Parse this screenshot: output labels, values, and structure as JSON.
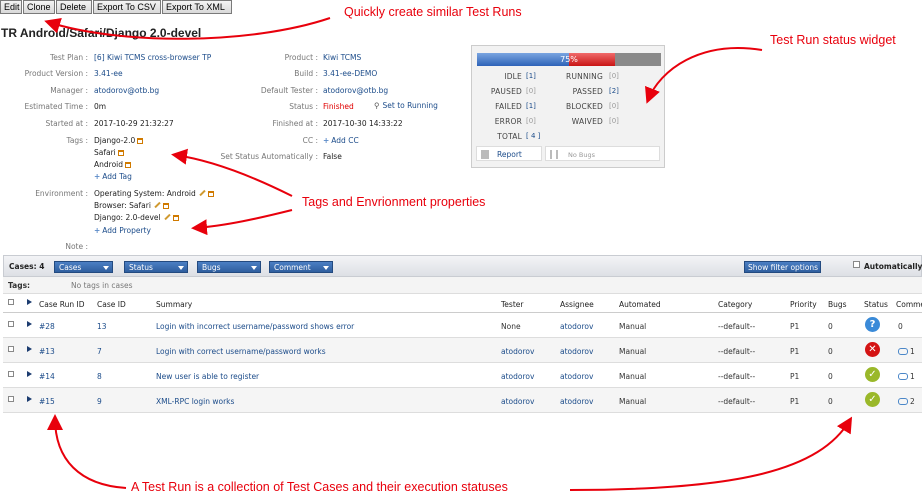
{
  "toolbar": {
    "edit": "Edit",
    "clone": "Clone",
    "delete": "Delete",
    "export_csv": "Export To CSV",
    "export_xml": "Export To XML"
  },
  "title": "TR Android/Safari/Django 2.0-devel",
  "details_left": {
    "test_plan_label": "Test Plan :",
    "test_plan_value": "[6] Kiwi TCMS cross-browser TP",
    "product_version_label": "Product Version :",
    "product_version_value": "3.41-ee",
    "manager_label": "Manager :",
    "manager_value": "atodorov@otb.bg",
    "estimated_time_label": "Estimated Time :",
    "estimated_time_value": "0m",
    "started_at_label": "Started at :",
    "started_at_value": "2017-10-29 21:32:27",
    "tags_label": "Tags :",
    "tags": [
      "Django-2.0",
      "Safari",
      "Android"
    ],
    "add_tag": "Add Tag",
    "environment_label": "Environment :",
    "environment": [
      "Operating System: Android",
      "Browser: Safari",
      "Django: 2.0-devel"
    ],
    "add_property": "Add Property",
    "note_label": "Note :"
  },
  "details_right": {
    "product_label": "Product :",
    "product_value": "Kiwi TCMS",
    "build_label": "Build :",
    "build_value": "3.41-ee-DEMO",
    "default_tester_label": "Default Tester :",
    "default_tester_value": "atodorov@otb.bg",
    "status_label": "Status :",
    "status_value": "Finished",
    "set_to_running": "Set to Running",
    "finished_at_label": "Finished at :",
    "finished_at_value": "2017-10-30 14:33:22",
    "cc_label": "CC :",
    "add_cc": "Add CC",
    "set_status_auto_label": "Set Status Automatically :",
    "set_status_auto_value": "False"
  },
  "status_widget": {
    "progress_percent": 75,
    "progress_label": "75%",
    "passed_fraction": 0.5,
    "failed_fraction": 0.25,
    "idle_label": "IDLE",
    "idle_count": "[1]",
    "running_label": "RUNNING",
    "running_count": "[0]",
    "paused_label": "PAUSED",
    "paused_count": "[0]",
    "passed_label": "PASSED",
    "passed_count": "[2]",
    "failed_label": "FAILED",
    "failed_count": "[1]",
    "blocked_label": "BLOCKED",
    "blocked_count": "[0]",
    "error_label": "ERROR",
    "error_count": "[0]",
    "waived_label": "WAIVED",
    "waived_count": "[0]",
    "total_label": "TOTAL",
    "total_count": "[ 4 ]",
    "report_label": "Report",
    "no_bugs_label": "No Bugs"
  },
  "filter_bar": {
    "cases_label": "Cases: 4",
    "cases_select": "Cases",
    "status_select": "Status",
    "bugs_select": "Bugs",
    "comment_select": "Comment",
    "show_filter": "Show filter options",
    "automatically": "Automatically"
  },
  "tags_row": {
    "label": "Tags:",
    "value": "No tags in cases"
  },
  "table": {
    "headers": {
      "case_run_id": "Case Run ID",
      "case_id": "Case ID",
      "summary": "Summary",
      "tester": "Tester",
      "assignee": "Assignee",
      "automated": "Automated",
      "category": "Category",
      "priority": "Priority",
      "bugs": "Bugs",
      "status": "Status",
      "comments": "Comme"
    },
    "rows": [
      {
        "run_id": "#28",
        "case_id": "13",
        "summary": "Login with incorrect username/password shows error",
        "tester": "None",
        "assignee": "atodorov",
        "automated": "Manual",
        "category": "--default--",
        "priority": "P1",
        "bugs": "0",
        "status": "idle",
        "status_glyph": "?",
        "comments": "0"
      },
      {
        "run_id": "#13",
        "case_id": "7",
        "summary": "Login with correct username/password works",
        "tester": "atodorov",
        "assignee": "atodorov",
        "automated": "Manual",
        "category": "--default--",
        "priority": "P1",
        "bugs": "0",
        "status": "failed",
        "status_glyph": "✕",
        "comments": "1"
      },
      {
        "run_id": "#14",
        "case_id": "8",
        "summary": "New user is able to register",
        "tester": "atodorov",
        "assignee": "atodorov",
        "automated": "Manual",
        "category": "--default--",
        "priority": "P1",
        "bugs": "0",
        "status": "passed",
        "status_glyph": "✓",
        "comments": "1"
      },
      {
        "run_id": "#15",
        "case_id": "9",
        "summary": "XML-RPC login works",
        "tester": "atodorov",
        "assignee": "atodorov",
        "automated": "Manual",
        "category": "--default--",
        "priority": "P1",
        "bugs": "0",
        "status": "passed",
        "status_glyph": "✓",
        "comments": "2"
      }
    ]
  },
  "status_colors": {
    "idle": "#3a8ad8",
    "failed": "#d41414",
    "passed": "#9ab82a",
    "annotation": "#e8000c"
  },
  "annotations": {
    "clone": "Quickly create similar Test Runs",
    "widget": "Test Run status widget",
    "tags": "Tags and Envrionment properties",
    "cases": "A Test Run is a collection of Test Cases and their execution statuses"
  }
}
